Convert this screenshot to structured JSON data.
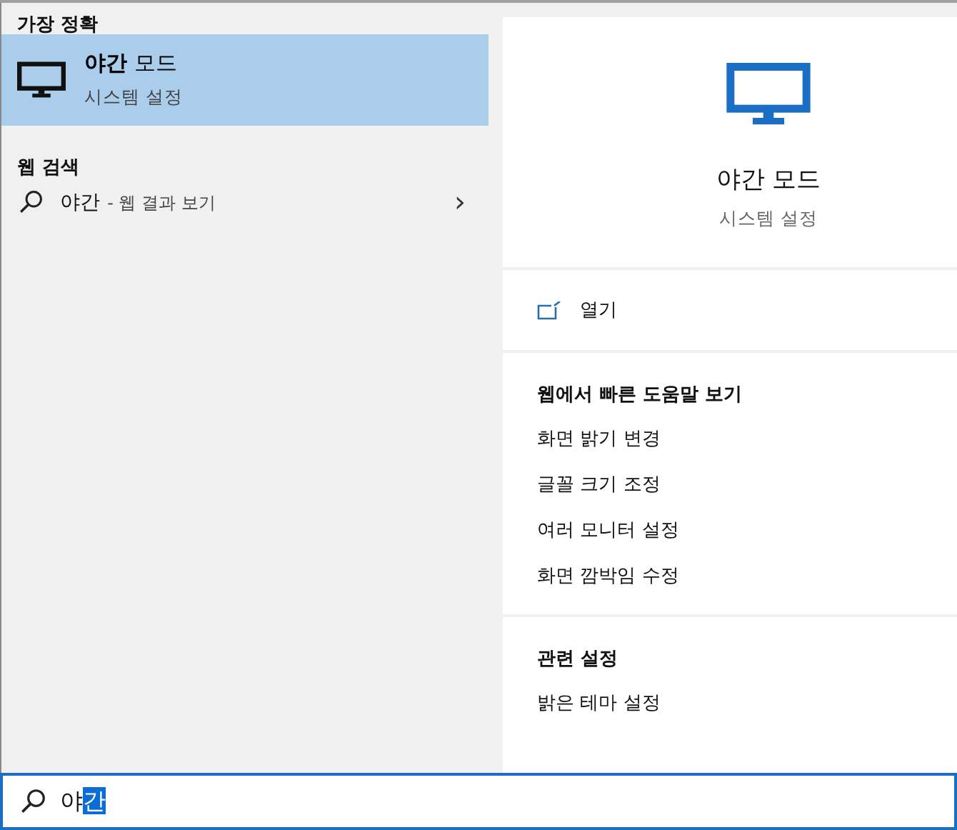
{
  "best_match": {
    "heading": "가장 정확",
    "item": {
      "title": "**야간** 모드",
      "subtitle": "시스템 설정",
      "selected": true
    }
  },
  "web_search": {
    "heading": "웹 검색",
    "item": {
      "query": "야간",
      "suffix": "- 웹 결과 보기",
      "chevron": "›"
    }
  },
  "detail": {
    "title": "야간 모드",
    "subtitle": "시스템 설정",
    "open_label": "열기",
    "sections": [
      {
        "heading": "웹에서 빠른 도움말 보기",
        "links": [
          "화면 밝기 변경",
          "글꼴 크기 조정",
          "여러 모니터 설정",
          "화면 깜박임 수정"
        ]
      },
      {
        "heading": "관련 설정",
        "links": [
          "밝은 테마 설정"
        ]
      }
    ]
  },
  "search": {
    "value": "야",
    "composing": "간"
  }
}
